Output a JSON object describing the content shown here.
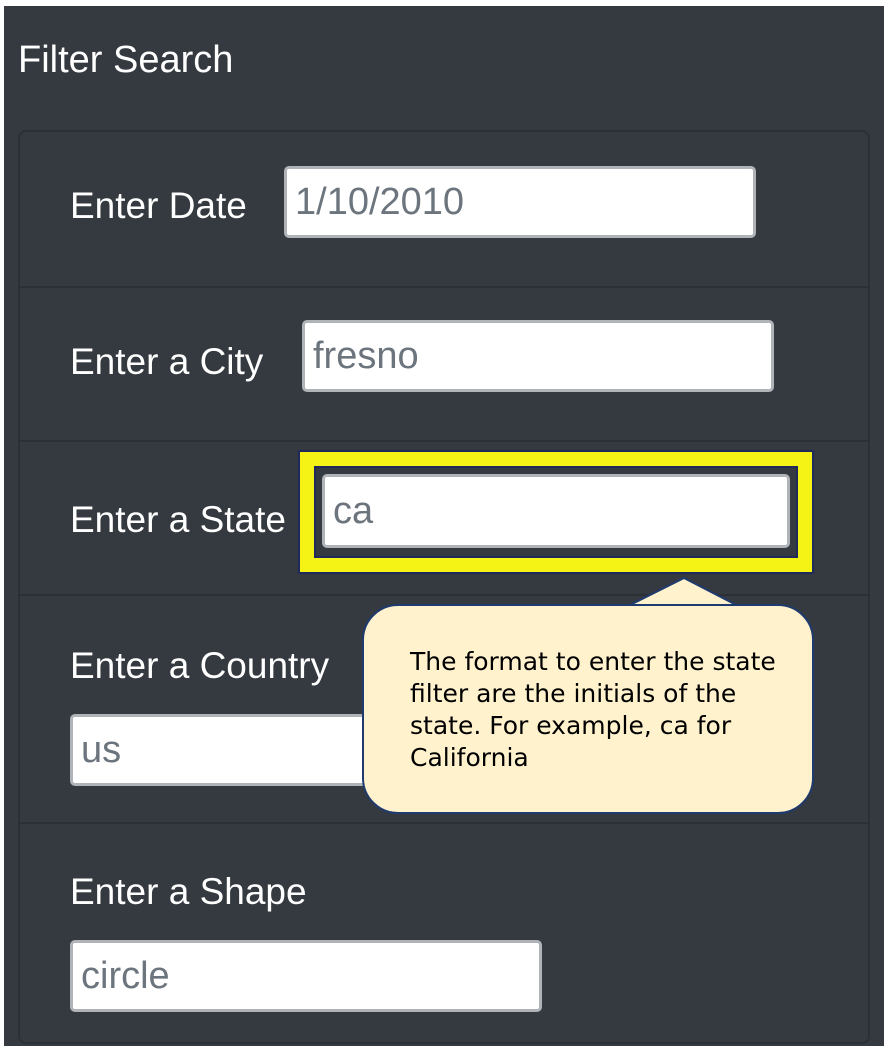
{
  "panel": {
    "title": "Filter Search"
  },
  "filters": [
    {
      "label": "Enter Date",
      "value": "1/10/2010"
    },
    {
      "label": "Enter a City",
      "value": "fresno"
    },
    {
      "label": "Enter a State",
      "value": "ca"
    },
    {
      "label": "Enter a Country",
      "value": "us"
    },
    {
      "label": "Enter a Shape",
      "value": "circle"
    }
  ],
  "callout": {
    "text": "The format to enter the state filter are the initials of the state. For example, ca for California"
  },
  "colors": {
    "panel_background": "#343a40",
    "highlight": "#f5f215",
    "callout_background": "#fff2cc"
  }
}
